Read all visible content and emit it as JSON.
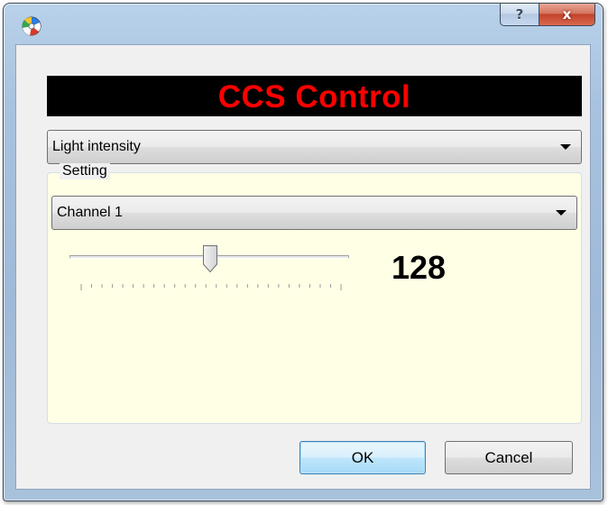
{
  "window": {
    "title": "",
    "icon": "ccs-app-icon",
    "caption_buttons": {
      "help_glyph": "?",
      "close_glyph": "x"
    }
  },
  "banner": {
    "text": "CCS Control",
    "text_color": "#ff0000",
    "background": "#000000"
  },
  "mode_select": {
    "selected": "Light intensity"
  },
  "setting_group": {
    "label": "Setting",
    "background": "#ffffe6",
    "channel_select": {
      "selected": "Channel 1"
    },
    "slider": {
      "min": 0,
      "max": 255,
      "value": 128
    },
    "value_display": "128"
  },
  "buttons": {
    "ok": "OK",
    "cancel": "Cancel"
  }
}
